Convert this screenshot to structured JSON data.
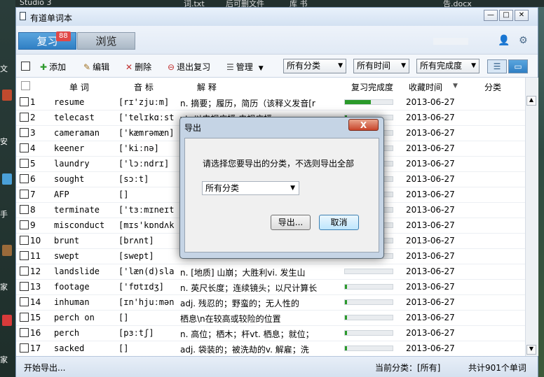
{
  "desktop": {
    "top_labels": [
      "Studio 3",
      "词.txt",
      "后可删文件",
      "库 书",
      "告.docx"
    ],
    "side_labels": [
      "文",
      "安",
      "手",
      "家",
      "家"
    ]
  },
  "window": {
    "title": "有道单词本",
    "controls": {
      "minimize": "—",
      "maximize": "□",
      "close": "✕"
    }
  },
  "tabs": {
    "review": "复习",
    "review_badge": "88",
    "browse": "浏览"
  },
  "header_icons": {
    "user": "user-icon",
    "settings": "gear-icon"
  },
  "toolbar": {
    "add": "添加",
    "edit": "编辑",
    "delete": "删除",
    "exit_review": "退出复习",
    "manage": "管理",
    "category_filter": "所有分类",
    "time_filter": "所有时间",
    "progress_filter": "所有完成度"
  },
  "columns": [
    "单 词",
    "音 标",
    "解 释",
    "复习完成度",
    "收藏时间",
    "分类"
  ],
  "rows": [
    {
      "n": "1",
      "word": "resume",
      "ph": "[rɪ'zjuːm]",
      "def": "n. 摘要；履历，简历（该释义发音[r",
      "progress": 0.55,
      "date": "2013-06-27"
    },
    {
      "n": "2",
      "word": "telecast",
      "ph": "['telɪkɑːst]",
      "def": "vt. 以电视广播 电视广播",
      "progress": 0.05,
      "date": "2013-06-27"
    },
    {
      "n": "3",
      "word": "cameraman",
      "ph": "['kæmrəmæn]",
      "def": "",
      "progress": 0.05,
      "date": "2013-06-27"
    },
    {
      "n": "4",
      "word": "keener",
      "ph": "['kiːnə]",
      "def": "",
      "progress": 0.05,
      "date": "2013-06-27"
    },
    {
      "n": "5",
      "word": "laundry",
      "ph": "['lɔːndrɪ]",
      "def": "",
      "progress": 0.05,
      "date": "2013-06-27"
    },
    {
      "n": "6",
      "word": "sought",
      "ph": "[sɔːt]",
      "def": "",
      "progress": 0.05,
      "date": "2013-06-27"
    },
    {
      "n": "7",
      "word": "AFP",
      "ph": "[]",
      "def": "",
      "progress": 0.05,
      "date": "2013-06-27"
    },
    {
      "n": "8",
      "word": "terminate",
      "ph": "['tɜːmɪneɪt]",
      "def": "",
      "progress": 0.05,
      "date": "2013-06-27"
    },
    {
      "n": "9",
      "word": "misconduct",
      "ph": "[mɪs'kɒndʌkt]",
      "def": "",
      "progress": 0.05,
      "date": "2013-06-27"
    },
    {
      "n": "10",
      "word": "brunt",
      "ph": "[brʌnt]",
      "def": "",
      "progress": 0.05,
      "date": "2013-06-27"
    },
    {
      "n": "11",
      "word": "swept",
      "ph": "[swept]",
      "def": "",
      "progress": 0.05,
      "date": "2013-06-27"
    },
    {
      "n": "12",
      "word": "landslide",
      "ph": "['læn(d)slaɪd]",
      "def": "n. [地质] 山崩；大胜利vi. 发生山",
      "progress": 0.0,
      "date": "2013-06-27"
    },
    {
      "n": "13",
      "word": "footage",
      "ph": "['fʊtɪdʒ]",
      "def": "n. 英尺长度；连续镜头；以尺计算长",
      "progress": 0.05,
      "date": "2013-06-27"
    },
    {
      "n": "14",
      "word": "inhuman",
      "ph": "[ɪn'hjuːmən]",
      "def": "adj. 残忍的；野蛮的；无人性的",
      "progress": 0.05,
      "date": "2013-06-27"
    },
    {
      "n": "15",
      "word": "perch on",
      "ph": "[]",
      "def": "栖息\\n在较高或较险的位置",
      "progress": 0.05,
      "date": "2013-06-27"
    },
    {
      "n": "16",
      "word": "perch",
      "ph": "[pɜːtʃ]",
      "def": "n. 高位；栖木；杆vt. 栖息；就位；",
      "progress": 0.05,
      "date": "2013-06-27"
    },
    {
      "n": "17",
      "word": "sacked",
      "ph": "[]",
      "def": "adj. 袋装的；被洗劫的v. 解雇；洗",
      "progress": 0.05,
      "date": "2013-06-27"
    }
  ],
  "status": {
    "left": "开始导出...",
    "category": "当前分类：[所有]",
    "total": "共计901个单词"
  },
  "dialog": {
    "title": "导出",
    "close": "X",
    "prompt": "请选择您要导出的分类，不选则导出全部",
    "select_value": "所有分类",
    "export_button": "导出...",
    "cancel_button": "取消"
  },
  "colors": {
    "accent": "#2f7fc4",
    "progress": "#2a9a2a",
    "badge": "#e04848"
  }
}
